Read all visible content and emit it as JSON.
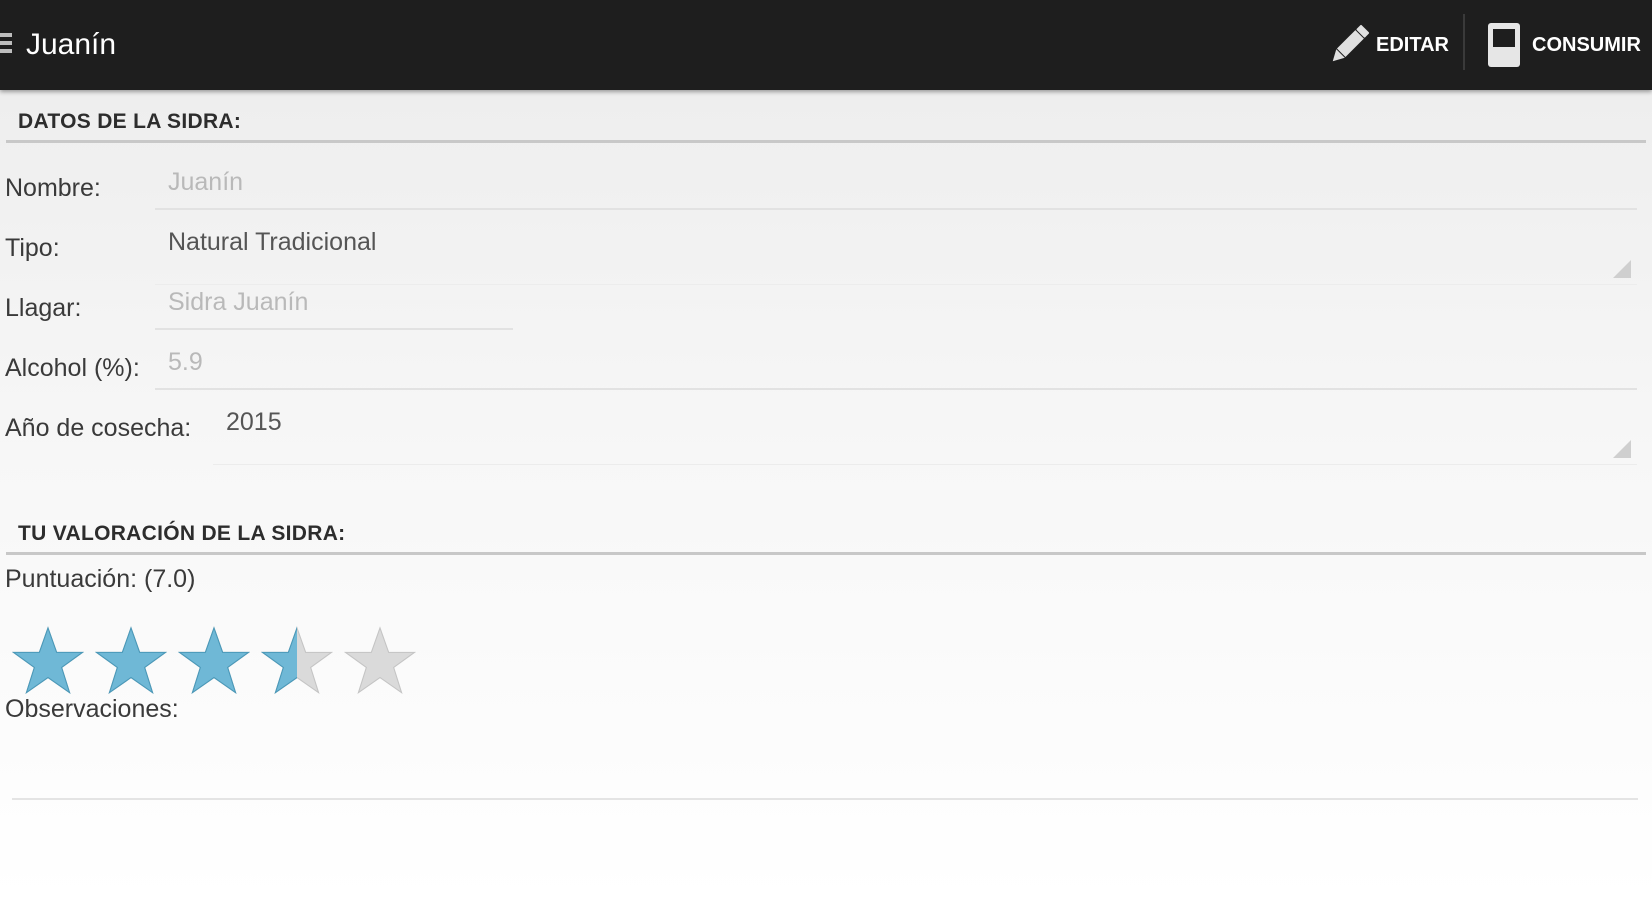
{
  "actionbar": {
    "title": "Juanín",
    "menu_icon": "hamburger-icon",
    "actions": {
      "editar": {
        "label": "EDITAR",
        "icon": "pencil-icon"
      },
      "consumir": {
        "label": "CONSUMIR",
        "icon": "glass-icon"
      }
    },
    "background": "#1e1e1e"
  },
  "datos": {
    "header": "DATOS DE LA SIDRA:",
    "nombre": {
      "label": "Nombre:",
      "value": "Juanín"
    },
    "tipo": {
      "label": "Tipo:",
      "value": "Natural Tradicional"
    },
    "llagar": {
      "label": "Llagar:",
      "value": "Sidra Juanín"
    },
    "alcohol": {
      "label": "Alcohol (%):",
      "value": "5.9"
    },
    "cosecha": {
      "label": "Año de cosecha:",
      "value": "2015"
    }
  },
  "valoracion": {
    "header": "TU VALORACIÓN DE LA SIDRA:",
    "puntuacion_label": "Puntuación:",
    "puntuacion_value": "(7.0)",
    "rating": 3.5,
    "rating_max": 5,
    "star_filled_color": "#6fb8d6",
    "star_empty_color": "#dadada",
    "observaciones_label": "Observaciones:",
    "observaciones_value": ""
  }
}
